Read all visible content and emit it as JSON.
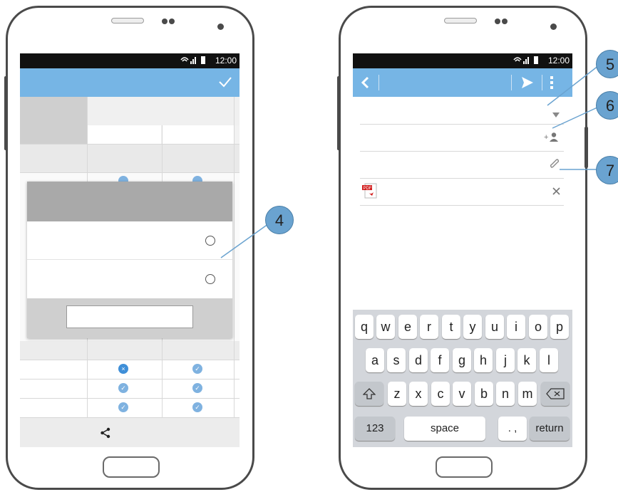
{
  "status": {
    "time": "12:00",
    "icons": "signal-wifi-battery"
  },
  "left_phone": {
    "appbar_check_icon": "check-icon",
    "share_icon": "share-icon",
    "callout": "4"
  },
  "right_phone": {
    "back_icon": "chevron-left-icon",
    "send_icon": "send-icon",
    "menu_icon": "kebab-menu-icon",
    "field_icons": [
      "dropdown-arrow-icon",
      "add-contact-icon",
      "paperclip-icon"
    ],
    "attachment_icon": "pdf-file-icon",
    "attachment_badge": "PDF",
    "remove_icon": "close-icon",
    "callouts": [
      "5",
      "6",
      "7"
    ],
    "keyboard": {
      "row1": [
        "q",
        "w",
        "e",
        "r",
        "t",
        "y",
        "u",
        "i",
        "o",
        "p"
      ],
      "row2": [
        "a",
        "s",
        "d",
        "f",
        "g",
        "h",
        "j",
        "k",
        "l"
      ],
      "row3": [
        "z",
        "x",
        "c",
        "v",
        "b",
        "n",
        "m"
      ],
      "numbers_label": "123",
      "space_label": "space",
      "punct_label": ". ,",
      "return_label": "return"
    }
  },
  "colors": {
    "accent": "#76b5e5",
    "callout": "#6aa3d0",
    "check": "#7fb2e0"
  }
}
